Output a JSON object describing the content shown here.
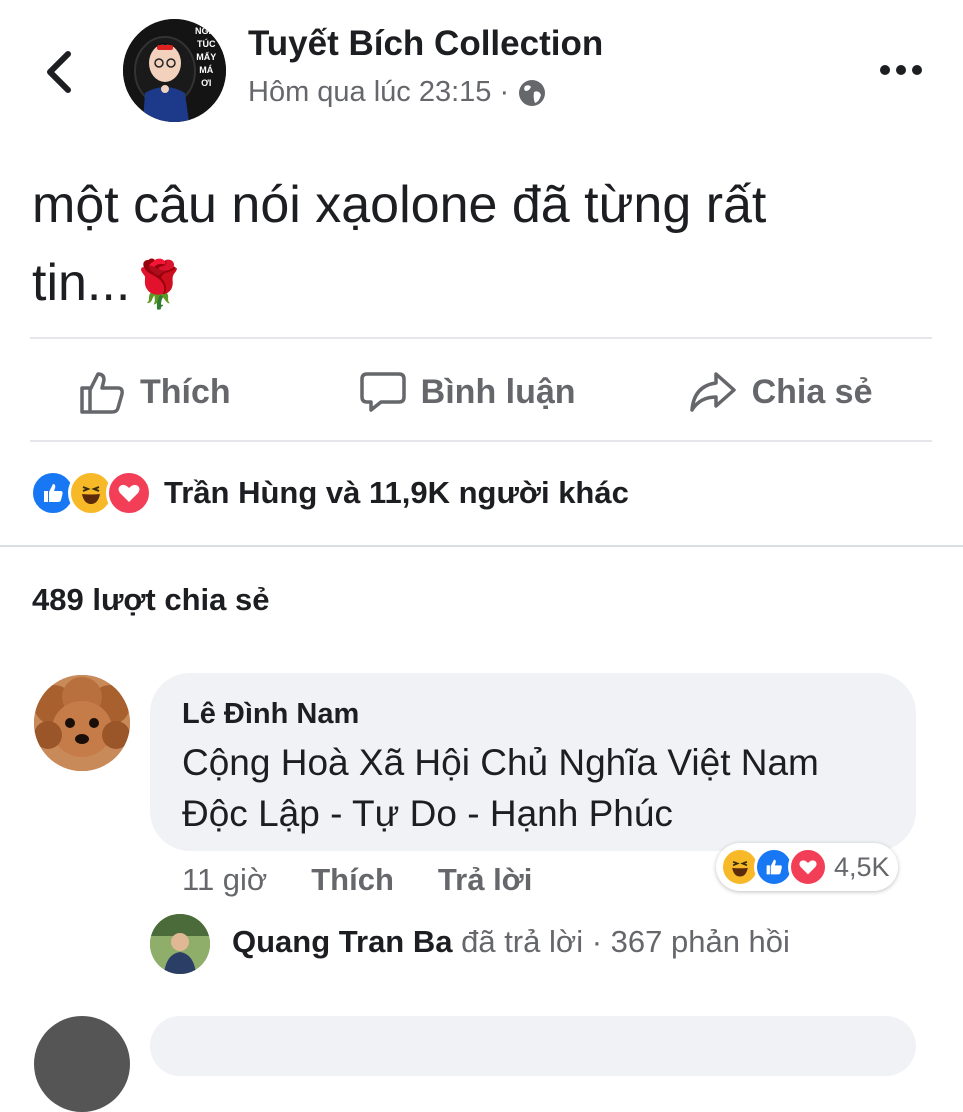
{
  "header": {
    "page_name": "Tuyết Bích Collection",
    "timestamp": "Hôm qua lúc 23:15",
    "separator": "·",
    "privacy_icon": "globe-icon",
    "back_icon": "chevron-left-icon",
    "more_icon": "more-dots-icon",
    "avatar_text": [
      "NGHỈ",
      "TÚC",
      "MẤY",
      "MÁ",
      "ƠI"
    ]
  },
  "post": {
    "line1": "một câu nói xạolone đã từng rất",
    "line2": "tin...",
    "emoji": "🌹"
  },
  "actions": {
    "like_label": "Thích",
    "comment_label": "Bình luận",
    "share_label": "Chia sẻ"
  },
  "reactions": {
    "icons": [
      "like-reaction-icon",
      "haha-reaction-icon",
      "love-reaction-icon"
    ],
    "summary": "Trần Hùng và 11,9K người khác"
  },
  "shares": "489 lượt chia sẻ",
  "comment": {
    "author": "Lê Đình Nam",
    "line1": "Cộng Hoà Xã Hội Chủ Nghĩa Việt Nam",
    "line2": "Độc Lập - Tự Do - Hạnh Phúc",
    "time": "11 giờ",
    "like_label": "Thích",
    "reply_label": "Trả lời",
    "reaction_count": "4,5K"
  },
  "reply": {
    "name": "Quang Tran Ba",
    "text": " đã trả lời · 367 phản hồi"
  },
  "colors": {
    "like_blue": "#1877f2",
    "haha_yellow": "#f7b928",
    "love_red": "#f33e58",
    "secondary_text": "#65676b",
    "bubble_bg": "#f0f2f5"
  }
}
